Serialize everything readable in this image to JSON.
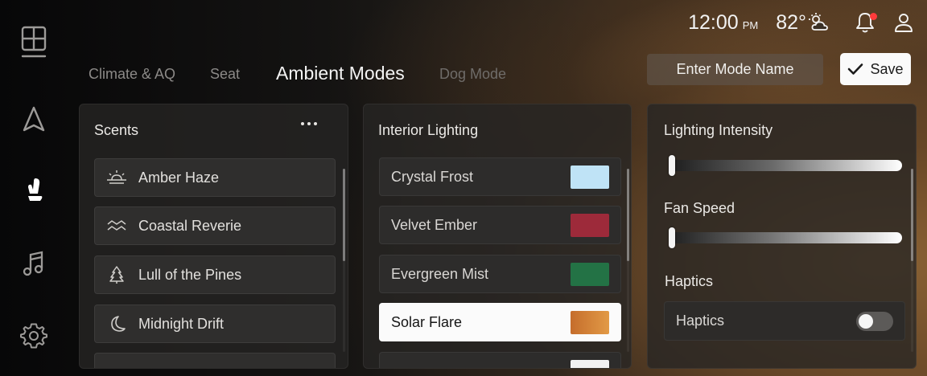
{
  "sidebar": {
    "items": [
      {
        "icon": "dashboard-icon",
        "active": false
      },
      {
        "icon": "navigation-icon",
        "active": false
      },
      {
        "icon": "seat-icon",
        "active": true
      },
      {
        "icon": "music-icon",
        "active": false
      },
      {
        "icon": "gear-icon",
        "active": false
      }
    ]
  },
  "status": {
    "time": "12:00",
    "ampm": "PM",
    "temperature": "82°",
    "weather_icon": "partly-cloudy-icon",
    "notification_icon": "bell-icon",
    "notification_dot_color": "#ff3b3b",
    "profile_icon": "user-icon"
  },
  "tabs": [
    {
      "label": "Climate & AQ"
    },
    {
      "label": "Seat"
    },
    {
      "label": "Ambient Modes",
      "active": true
    },
    {
      "label": "Dog Mode"
    }
  ],
  "mode_name": {
    "placeholder": "Enter Mode Name"
  },
  "save": {
    "label": "Save",
    "icon": "check-icon"
  },
  "scents": {
    "title": "Scents",
    "menu_icon": "more-horizontal-icon",
    "items": [
      {
        "label": "Amber Haze",
        "icon": "sunrise-icon"
      },
      {
        "label": "Coastal Reverie",
        "icon": "waves-icon"
      },
      {
        "label": "Lull of the Pines",
        "icon": "pine-tree-icon"
      },
      {
        "label": "Midnight Drift",
        "icon": "moon-icon"
      }
    ]
  },
  "lighting": {
    "title": "Interior Lighting",
    "items": [
      {
        "label": "Crystal Frost",
        "color": "#bfe3f6"
      },
      {
        "label": "Velvet Ember",
        "color": "#9d2a3a"
      },
      {
        "label": "Evergreen Mist",
        "color": "#237245"
      },
      {
        "label": "Solar Flare",
        "color": "#d88638",
        "selected": true
      }
    ]
  },
  "intensity": {
    "label": "Lighting Intensity",
    "value": 0
  },
  "fan": {
    "label": "Fan Speed",
    "value": 0
  },
  "haptics": {
    "section_label": "Haptics",
    "toggle_label": "Haptics",
    "enabled": false
  }
}
